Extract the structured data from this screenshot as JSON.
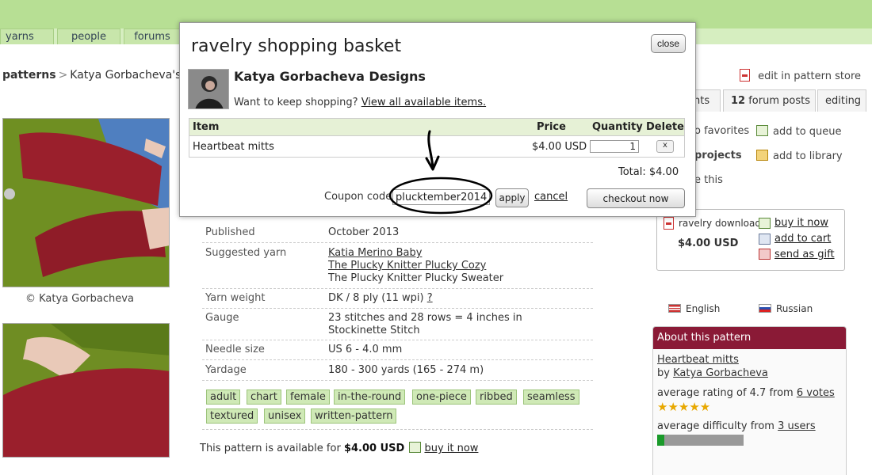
{
  "nav": {
    "tabs": [
      "yarns",
      "people",
      "forums"
    ]
  },
  "breadcrumb": {
    "root": "patterns",
    "separator": ">",
    "current": "Katya Gorbacheva's"
  },
  "photo_credit": "© Katya Gorbacheva",
  "store": {
    "edit_link": "edit in pattern store"
  },
  "tabs_right": {
    "partial": "nts",
    "forum_count": "12",
    "forum_label": "forum posts",
    "editing": "editing"
  },
  "side_actions": {
    "favorites": "o favorites",
    "add_queue": "add to queue",
    "projects": "projects",
    "add_library": "add to library",
    "this": "e this"
  },
  "buybox": {
    "downloads_label": "ravelry downloads",
    "price": "$4.00 USD",
    "buy": "buy it now",
    "cart": "add to cart",
    "gift": "send as gift"
  },
  "languages": [
    "English",
    "Russian"
  ],
  "about": {
    "header": "About this pattern",
    "pattern_name": "Heartbeat mitts",
    "by_label": "by",
    "author": "Katya Gorbacheva",
    "rating_text": "average rating of 4.7 from",
    "rating_votes": "6 votes",
    "stars": "★★★★★",
    "difficulty_text": "average difficulty from",
    "difficulty_users": "3 users",
    "difficulty_level": 0.08
  },
  "details": [
    {
      "key": "Published",
      "value": [
        "October 2013"
      ]
    },
    {
      "key": "Suggested yarn",
      "links": [
        "Katia Merino Baby",
        "The Plucky Knitter Plucky Cozy"
      ],
      "value": [
        "The Plucky Knitter Plucky Sweater"
      ]
    },
    {
      "key": "Yarn weight",
      "value": [
        "DK / 8 ply (11 wpi)"
      ],
      "help": "?"
    },
    {
      "key": "Gauge",
      "value": [
        "23 stitches and 28 rows = 4 inches in",
        "Stockinette Stitch"
      ]
    },
    {
      "key": "Needle size",
      "value": [
        "US 6 - 4.0 mm"
      ]
    },
    {
      "key": "Yardage",
      "value": [
        "180 - 300 yards (165 - 274 m)"
      ]
    }
  ],
  "tags": [
    "adult",
    "chart",
    "female",
    "in-the-round",
    "one-piece",
    "ribbed",
    "seamless",
    "textured",
    "unisex",
    "written-pattern"
  ],
  "availability": {
    "prefix": "This pattern is available for",
    "price": "$4.00 USD",
    "buy": "buy it now"
  },
  "modal": {
    "title": "ravelry shopping basket",
    "close": "close",
    "designer": "Katya Gorbacheva Designs",
    "keep_prefix": "Want to keep shopping?",
    "keep_link": "View all available items.",
    "headers": {
      "item": "Item",
      "price": "Price",
      "quantity": "Quantity",
      "delete": "Delete"
    },
    "row": {
      "item": "Heartbeat mitts",
      "price": "$4.00 USD",
      "quantity": "1",
      "delete": "x"
    },
    "total": "Total: $4.00",
    "coupon_label": "Coupon code:",
    "coupon_value": "plucktember2014",
    "apply": "apply",
    "cancel": "cancel",
    "checkout": "checkout now"
  },
  "colors": {
    "topbar": "#b7df94",
    "tag_bg": "#cfe9b6",
    "about_header": "#8a1a36",
    "difficulty_fill": "#1a9a2a"
  }
}
